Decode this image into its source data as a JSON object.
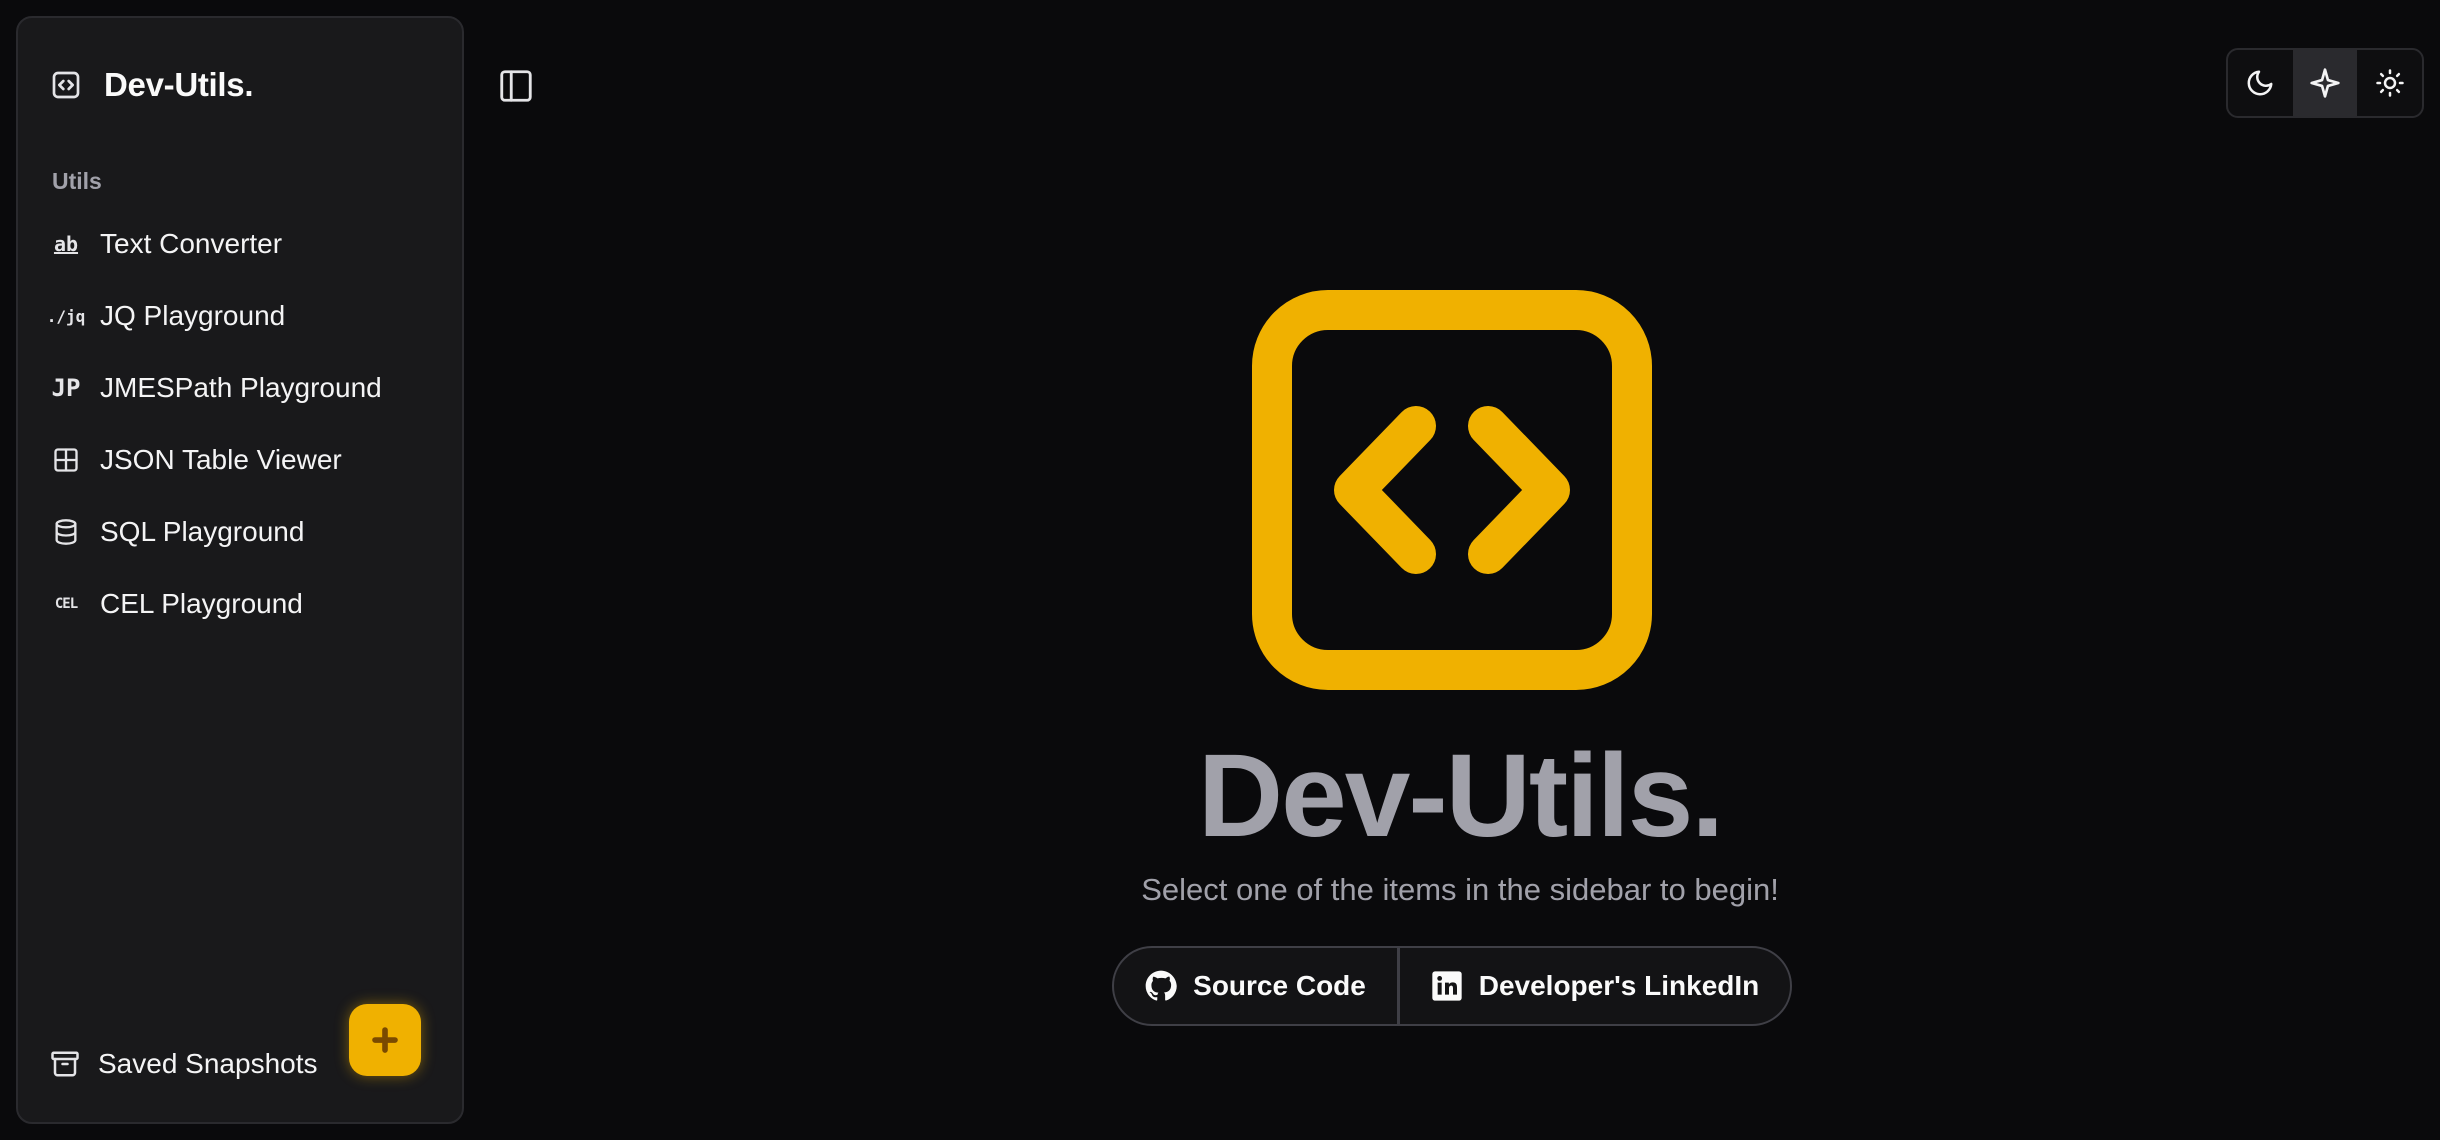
{
  "sidebar": {
    "brand": "Dev-Utils.",
    "section_label": "Utils",
    "items": [
      {
        "label": "Text Converter",
        "icon": "text-converter-icon",
        "glyph": "ab"
      },
      {
        "label": "JQ Playground",
        "icon": "jq-icon",
        "glyph": "./jq"
      },
      {
        "label": "JMESPath Playground",
        "icon": "jmespath-icon",
        "glyph": "JP"
      },
      {
        "label": "JSON Table Viewer",
        "icon": "table-icon",
        "glyph": ""
      },
      {
        "label": "SQL Playground",
        "icon": "database-icon",
        "glyph": ""
      },
      {
        "label": "CEL Playground",
        "icon": "cel-icon",
        "glyph": "CEL"
      }
    ],
    "footer": {
      "label": "Saved Snapshots",
      "icon": "archive-icon"
    },
    "add_button": {
      "icon": "plus-icon"
    }
  },
  "header": {
    "sidebar_toggle_icon": "sidebar-toggle-icon",
    "theme_options": [
      "moon-icon",
      "sparkle-icon",
      "sun-icon"
    ],
    "theme_active": "sparkle-icon"
  },
  "main": {
    "title": "Dev-Utils.",
    "subtitle": "Select one of the items in the sidebar to begin!",
    "links": [
      {
        "label": "Source Code",
        "icon": "github-icon"
      },
      {
        "label": "Developer's LinkedIn",
        "icon": "linkedin-icon"
      }
    ]
  },
  "colors": {
    "accent": "#f0b100",
    "background": "#0a0a0c",
    "sidebar": "#19191b",
    "muted_text": "#a1a1aa"
  }
}
